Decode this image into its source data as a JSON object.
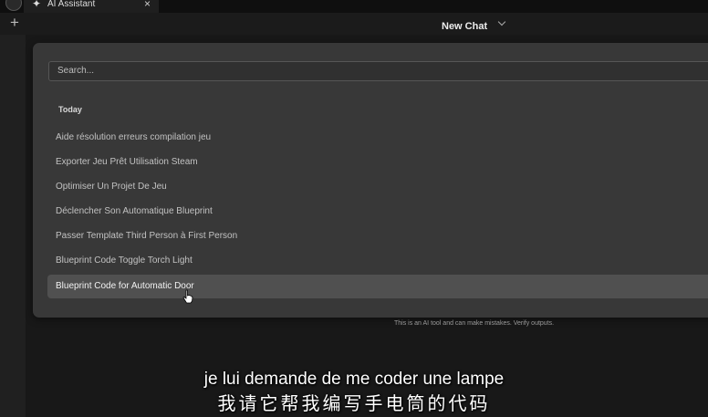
{
  "tab": {
    "icon": "sparkle-icon",
    "title": "AI Assistant",
    "close_label": "×"
  },
  "toolbar": {
    "new_tab_label": "+",
    "chat_title": "New Chat",
    "dropdown_icon": "chevron-down-icon"
  },
  "history": {
    "search_placeholder": "Search...",
    "group_label": "Today",
    "items": [
      {
        "label": "Aide résolution erreurs compilation jeu"
      },
      {
        "label": "Exporter Jeu Prêt Utilisation Steam"
      },
      {
        "label": "Optimiser Un Projet De Jeu"
      },
      {
        "label": "Déclencher Son Automatique Blueprint"
      },
      {
        "label": "Passer Template Third Person à First Person"
      },
      {
        "label": "Blueprint Code Toggle Torch Light"
      },
      {
        "label": "Blueprint Code for Automatic Door",
        "selected": true
      }
    ]
  },
  "disclaimer": "This is an AI tool and can make mistakes. Verify outputs.",
  "subtitles": {
    "fr": "je lui demande de me coder une lampe",
    "zh": "我请它帮我编写手电筒的代码"
  },
  "colors": {
    "background": "#181818",
    "panel": "#383838",
    "selected_row": "#505050"
  }
}
